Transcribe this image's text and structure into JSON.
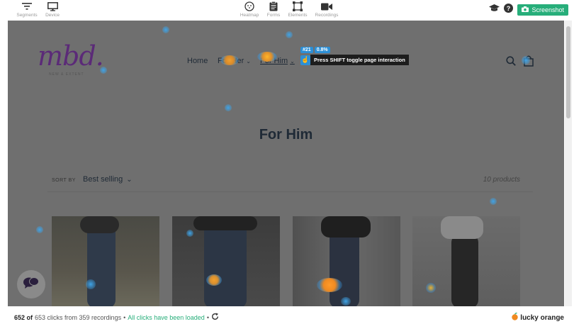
{
  "toolbar": {
    "left": [
      {
        "label": "Segments",
        "icon": "filter-icon"
      },
      {
        "label": "Device",
        "icon": "monitor-icon"
      }
    ],
    "center": [
      {
        "label": "Heatmap",
        "icon": "heatmap-icon"
      },
      {
        "label": "Forms",
        "icon": "clipboard-icon"
      },
      {
        "label": "Elements",
        "icon": "elements-icon"
      },
      {
        "label": "Recordings",
        "icon": "video-icon"
      }
    ],
    "screenshot_label": "Screenshot",
    "accent": "#27ae7a"
  },
  "site": {
    "logo": "mbd.",
    "logo_sub": "NEW & EXTENT",
    "nav": {
      "home": "Home",
      "for_her": "For Her",
      "for_him": "For Him"
    },
    "page_title": "For Him",
    "sort_label": "SORT BY",
    "sort_value": "Best selling",
    "product_count": "10 products"
  },
  "tooltip": {
    "element_id": "#21",
    "percent": "0.8%",
    "message": "Press SHIFT toggle page interaction"
  },
  "status": {
    "shown": "652 of",
    "summary": "653 clicks from 359 recordings",
    "sep": "•",
    "loaded": "All clicks have been loaded"
  },
  "brand": "lucky orange"
}
